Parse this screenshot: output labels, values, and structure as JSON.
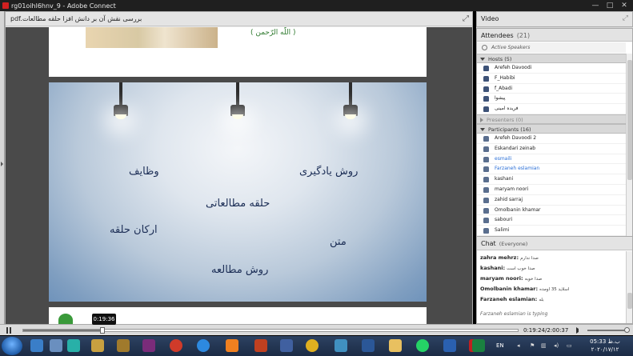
{
  "window": {
    "title": "rg01oihl6hnv_9 - Adobe Connect",
    "minimize": "—",
    "maximize": "□",
    "close": "✕"
  },
  "share_pod": {
    "doc_title": "pdf.بررسی نقش آن بر دانش افزا حلقه مطالعات",
    "fullscreen_icon": "expand-icon",
    "top_page_text": "( اللّٰه الرّحمن )",
    "slide_words": [
      "روش یادگیری",
      "وظایف",
      "حلقه مطالعاتی",
      "ارکان حلقه",
      "متن",
      "روش مطالعه"
    ]
  },
  "video_pod": {
    "title": "Video"
  },
  "attendees": {
    "title": "Attendees",
    "count": "(21)",
    "active_speakers": "Active Speakers",
    "groups": [
      {
        "label": "Hosts (5)",
        "collapsed": false,
        "people": [
          "Arefeh Davoodi",
          "F_Habibi",
          "f_Abadi",
          "پیشوا",
          "فریده امینی"
        ]
      },
      {
        "label": "Presenters (0)",
        "collapsed": true,
        "people": []
      },
      {
        "label": "Participants (16)",
        "collapsed": false,
        "people": [
          "Arefeh Davoodi 2",
          "Eskandari zeinab",
          "esmaili",
          "Farzaneh eslamian",
          "kashani",
          "maryam noori",
          "zahid sarraj",
          "Omolbanin khamar",
          "sabouri",
          "Salimi"
        ]
      }
    ],
    "highlighted": [
      "esmaili",
      "Farzaneh eslamian"
    ]
  },
  "chat": {
    "title": "Chat",
    "scope": "(Everyone)",
    "messages": [
      {
        "name": "zahra mehrz:",
        "text": "صدا ندارم"
      },
      {
        "name": "kashani:",
        "text": "صدا خوب است"
      },
      {
        "name": "maryam noori:",
        "text": "صدا خوبه"
      },
      {
        "name": "Omolbanin khamar:",
        "text": "اسلاید 35 اومده"
      },
      {
        "name": "Farzaneh eslamian:",
        "text": "بله"
      }
    ],
    "typing": "Farzaneh eslamian is typing"
  },
  "playback": {
    "time_tooltip": "0:19:36",
    "time_readout": "0:19:24/2:00:37",
    "progress": 0.161,
    "volume": 1.0
  },
  "taskbar": {
    "language": "EN",
    "clock_time": "05:33 ب.ظ",
    "clock_date": "۲۰۲۰/۱۷/۱۲"
  }
}
